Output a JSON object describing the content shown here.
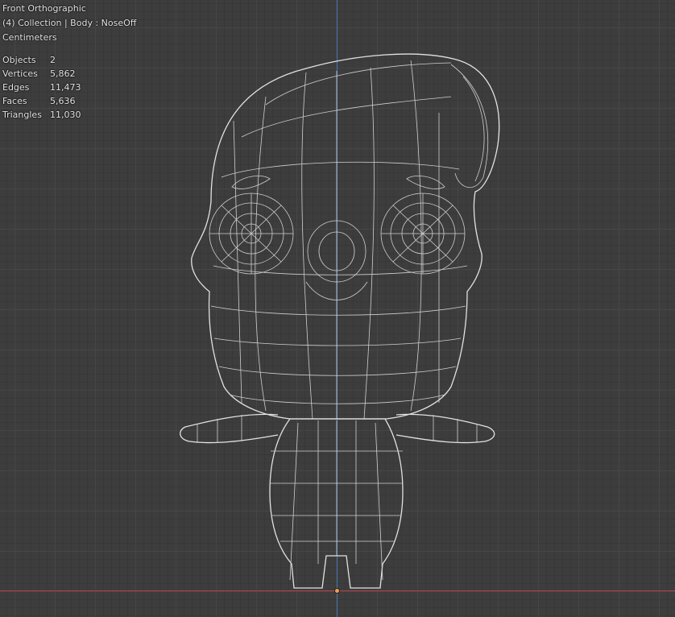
{
  "viewport": {
    "view_name": "Front Orthographic",
    "context": "(4) Collection | Body : NoseOff",
    "units": "Centimeters"
  },
  "stats": [
    {
      "label": "Objects",
      "value": "2"
    },
    {
      "label": "Vertices",
      "value": "5,862"
    },
    {
      "label": "Edges",
      "value": "11,473"
    },
    {
      "label": "Faces",
      "value": "5,636"
    },
    {
      "label": "Triangles",
      "value": "11,030"
    }
  ],
  "colors": {
    "background": "#3d3d3d",
    "grid": "#464646",
    "wire": "#cfcfcf",
    "axis_z": "#4a78b8",
    "axis_x": "#b4414a",
    "origin": "#f3a04a"
  }
}
